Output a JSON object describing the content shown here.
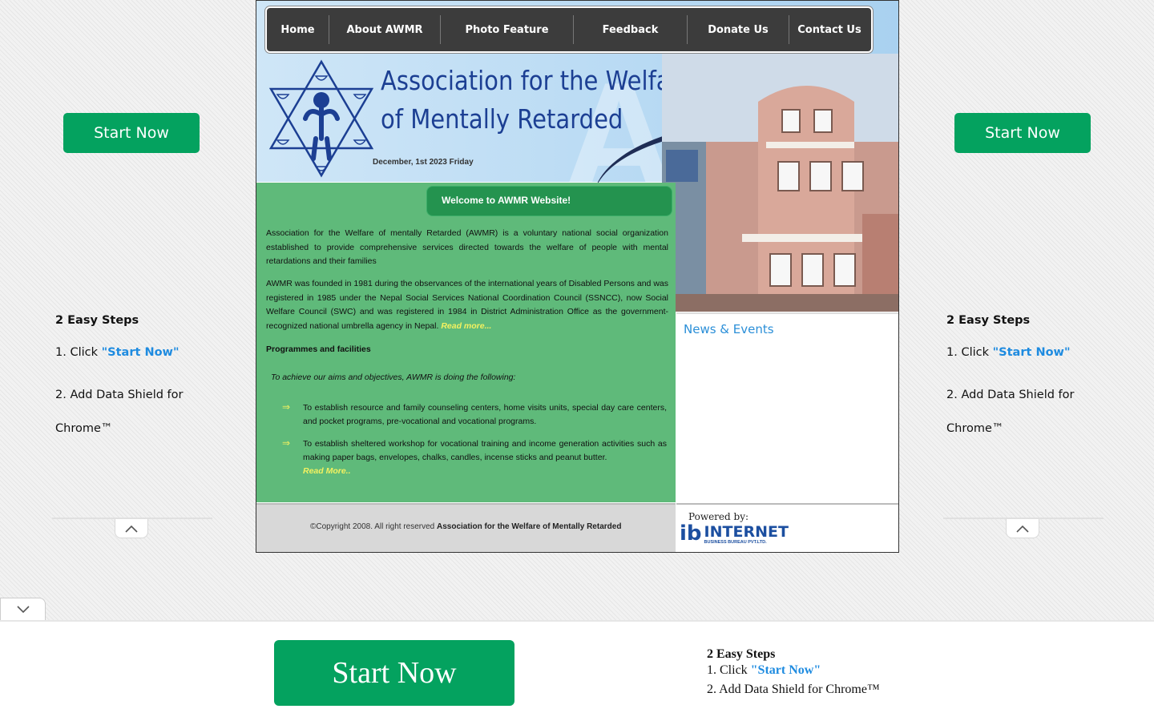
{
  "ads": {
    "start_now_label": "Start Now",
    "steps_title": "2 Easy Steps",
    "step1_prefix": "1. Click ",
    "step1_link": "\"Start Now\"",
    "step2_line1": "2. Add Data Shield for",
    "step2_line2": "Chrome™",
    "collapse_icon": "chevron-up-icon",
    "expand_icon": "chevron-down-icon"
  },
  "bottom_banner": {
    "start_now_label": "Start Now",
    "steps_title": "2 Easy Steps",
    "step1_prefix": "1. Click ",
    "step1_link": "\"Start Now\"",
    "step2": "2. Add Data Shield for Chrome™"
  },
  "site": {
    "nav": [
      {
        "label": "Home"
      },
      {
        "label": "About AWMR"
      },
      {
        "label": "Photo Feature"
      },
      {
        "label": "Feedback"
      },
      {
        "label": "Donate Us"
      },
      {
        "label": "Contact Us"
      }
    ],
    "org_title_line1": "Association for the Welfare",
    "org_title_line2": "of Mentally Retarded",
    "watermark": "AWMR",
    "date": "December, 1st 2023 Friday",
    "welcome": "Welcome to AWMR Website!",
    "intro": "Association for the Welfare of mentally Retarded (AWMR)  is a voluntary national social organization established to provide comprehensive services directed towards the welfare of people with mental retardations and their families",
    "history": "AWMR was founded in 1981 during the observances of the international years of Disabled Persons and was registered in 1985 under the Nepal Social Services National Coordination Council (SSNCC), now Social Welfare Council (SWC) and was registered in 1984 in District Administration Office as the government-recognized national umbrella agency in Nepal.",
    "read_more": "Read more...",
    "programmes_title": "Programmes and facilities",
    "aims": "To achieve our aims and objectives, AWMR is doing the following:",
    "bullets": [
      {
        "text": "To establish resource and family counseling centers, home visits units, special day care centers, and pocket programs, pre-vocational and vocational programs."
      },
      {
        "text": "To establish sheltered workshop for vocational training and income generation activities such as making paper bags, envelopes, chalks, candles, incense sticks and peanut butter."
      }
    ],
    "bullet_read_more": "Read More..",
    "news_title": "News & Events",
    "copyright_prefix": "©Copyright 2008. All right reserved ",
    "copyright_org": "Association for the Welfare of Mentally Retarded",
    "powered_by": "Powered by:",
    "powered_logo_mark": "ib",
    "powered_logo_name": "INTERNET",
    "powered_logo_sub": "BUSINESS BUREAU PVT.LTD."
  },
  "colors": {
    "ad_green": "#04a25f",
    "panel_green": "#5fba7a",
    "welcome_green": "#24934f",
    "link_blue": "#1e8be0",
    "title_blue": "#1c3f93",
    "read_more_yellow": "#f3f160"
  }
}
